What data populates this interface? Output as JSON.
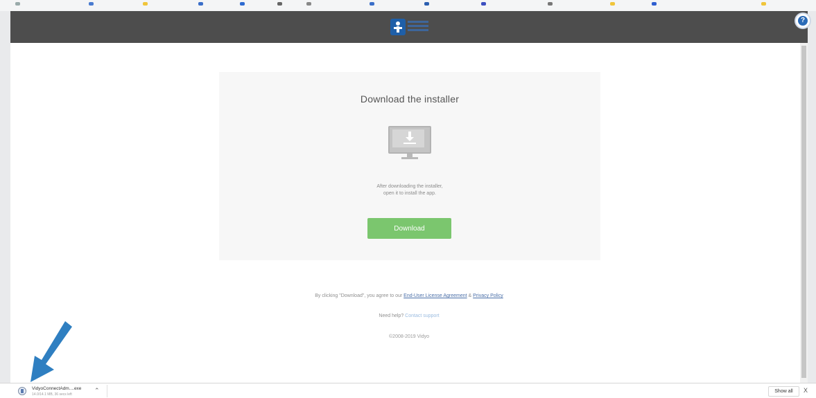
{
  "page": {
    "card_title": "Download the installer",
    "card_desc_line1": "After downloading the installer,",
    "card_desc_line2": "open it to install the app.",
    "download_label": "Download",
    "legal_prefix": "By clicking \"Download\", you agree to our ",
    "eula_link": "End-User License Agreement",
    "legal_and": " & ",
    "privacy_link": "Privacy Policy",
    "help_prefix": "Need help? ",
    "help_link": "Contact support",
    "copyright": "©2008-2019 Vidyo"
  },
  "download_shelf": {
    "file_name": "VidyoConnectAdm....exe",
    "file_status": "14.0/14.1 MB, 36 secs left",
    "show_all_label": "Show all",
    "close_label": "X"
  },
  "colors": {
    "header": "#4d4d4d",
    "download_button": "#7bc66e",
    "annotation_arrow": "#2f7fc1",
    "card_background": "#f7f7f7"
  },
  "icons": [
    "vidyo-logo",
    "monitor-download-icon",
    "help-chat-icon",
    "annotation-arrow",
    "file-icon",
    "chevron-up-icon",
    "close-icon"
  ]
}
